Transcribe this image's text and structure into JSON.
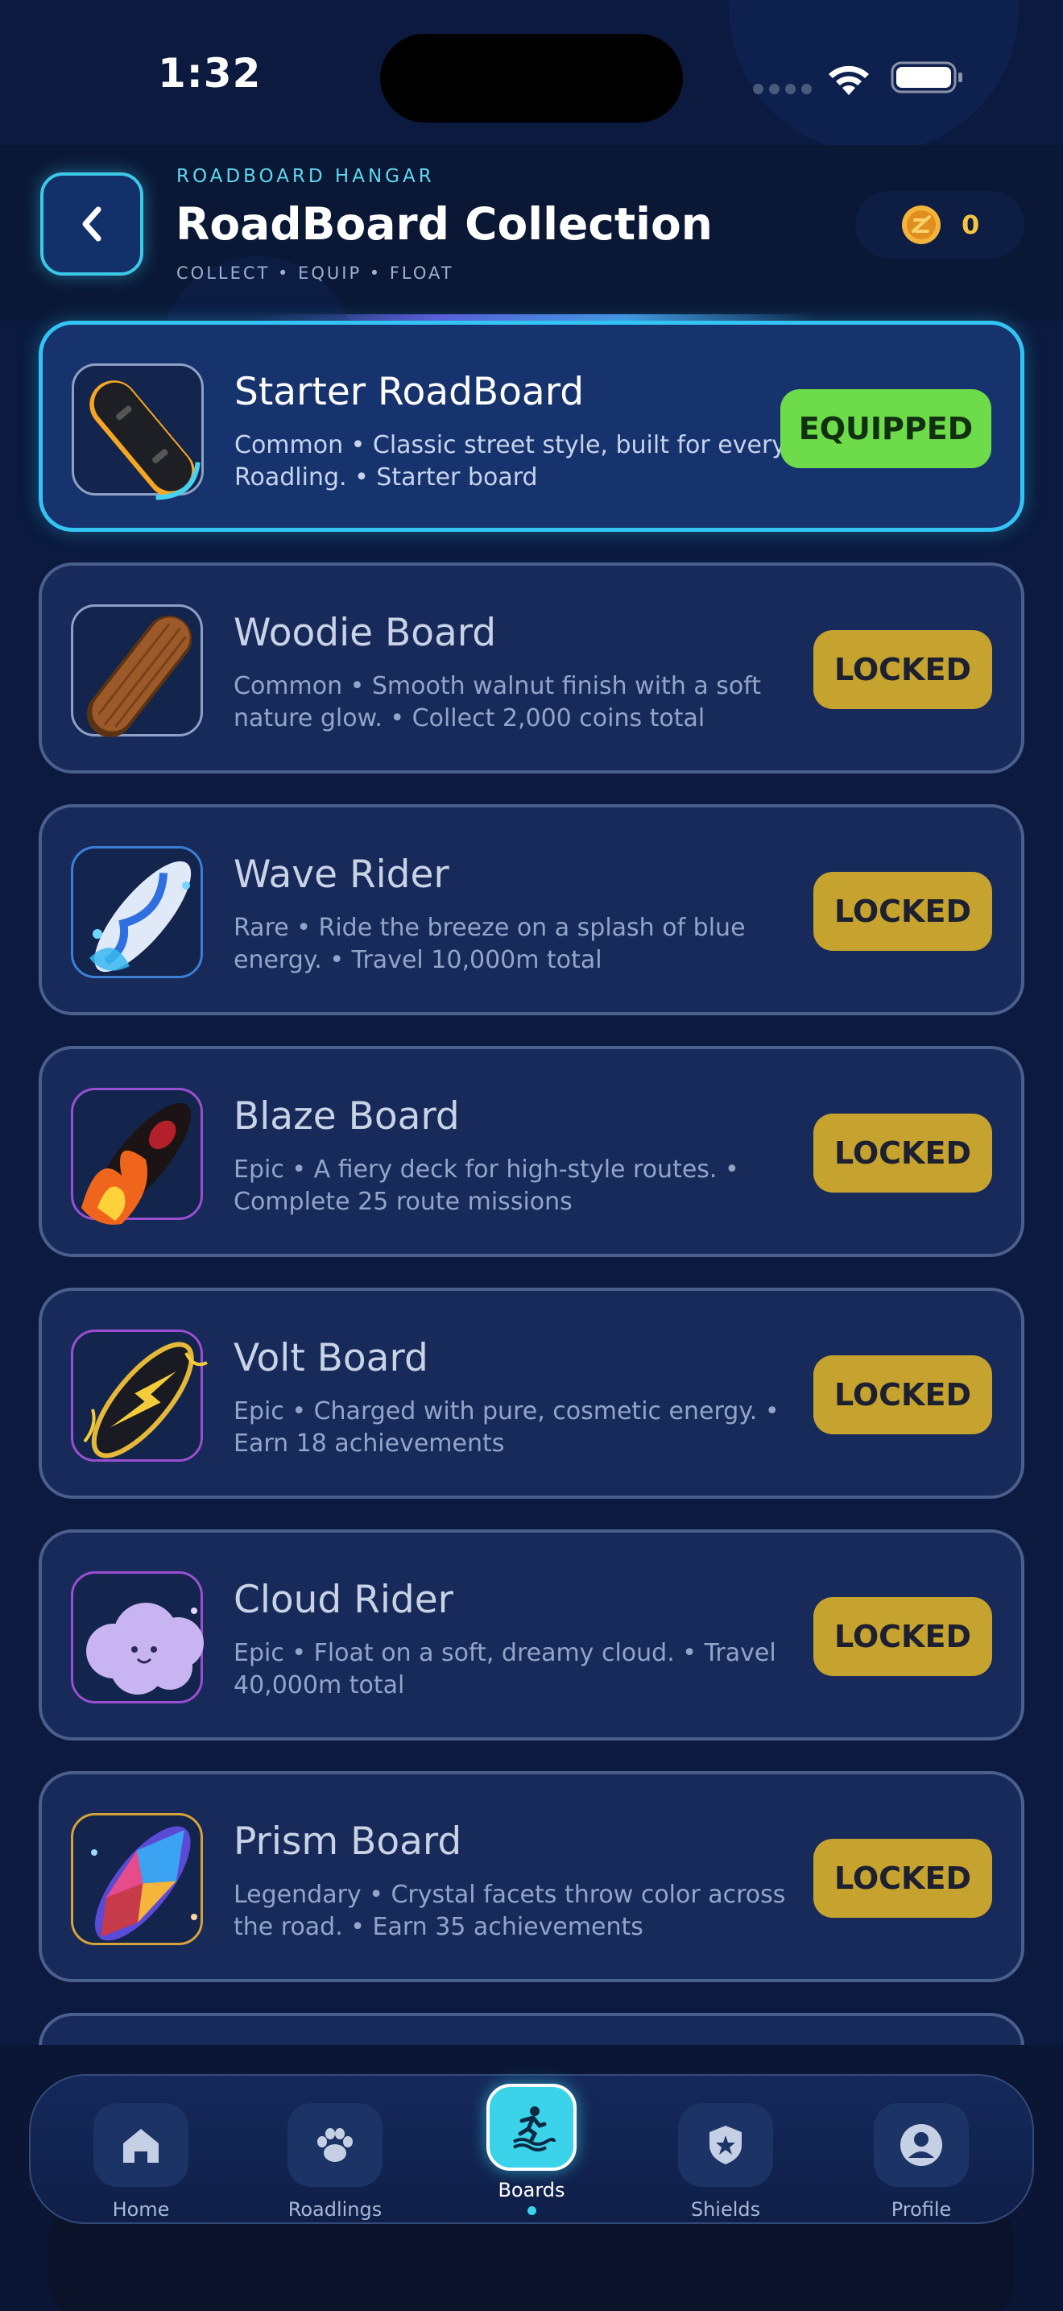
{
  "status_bar": {
    "time": "1:32"
  },
  "header": {
    "eyebrow": "ROADBOARD HANGAR",
    "title": "RoadBoard Collection",
    "subtitle": "COLLECT • EQUIP • FLOAT",
    "coins": "0"
  },
  "colors": {
    "accent": "#33c4f4",
    "equipped": "#6ddb4a",
    "locked": "#c6a32e",
    "background": "#0b1a3e"
  },
  "boards": [
    {
      "name": "Starter RoadBoard",
      "description": "Common • Classic street style, built for every Roadling. • Starter board",
      "status": "EQUIPPED",
      "icon": "starter-board-icon"
    },
    {
      "name": "Woodie Board",
      "description": "Common • Smooth walnut finish with a soft nature glow. • Collect 2,000 coins total",
      "status": "LOCKED",
      "icon": "woodie-board-icon"
    },
    {
      "name": "Wave Rider",
      "description": "Rare • Ride the breeze on a splash of blue energy. • Travel 10,000m total",
      "status": "LOCKED",
      "icon": "wave-rider-icon"
    },
    {
      "name": "Blaze Board",
      "description": "Epic • A fiery deck for high-style routes. • Complete 25 route missions",
      "status": "LOCKED",
      "icon": "blaze-board-icon"
    },
    {
      "name": "Volt Board",
      "description": "Epic • Charged with pure, cosmetic energy. • Earn 18 achievements",
      "status": "LOCKED",
      "icon": "volt-board-icon"
    },
    {
      "name": "Cloud Rider",
      "description": "Epic • Float on a soft, dreamy cloud. • Travel 40,000m total",
      "status": "LOCKED",
      "icon": "cloud-rider-icon"
    },
    {
      "name": "Prism Board",
      "description": "Legendary • Crystal facets throw color across the road. • Earn 35 achievements",
      "status": "LOCKED",
      "icon": "prism-board-icon"
    }
  ],
  "nav": [
    {
      "label": "Home",
      "icon": "home-icon"
    },
    {
      "label": "Roadlings",
      "icon": "paw-icon"
    },
    {
      "label": "Boards",
      "icon": "surfer-icon",
      "active": true
    },
    {
      "label": "Shields",
      "icon": "shield-star-icon"
    },
    {
      "label": "Profile",
      "icon": "profile-icon"
    }
  ]
}
